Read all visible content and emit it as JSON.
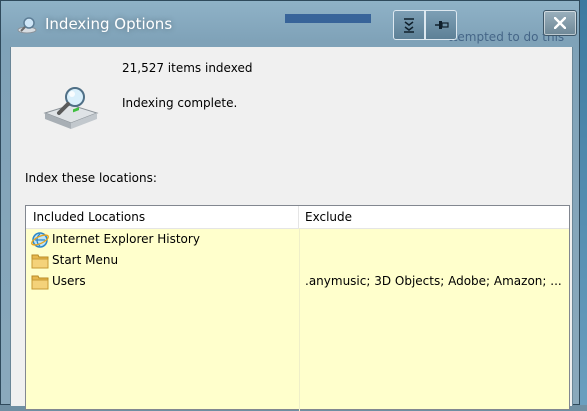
{
  "window": {
    "title": "Indexing Options",
    "background_hint": "ttempted to do this"
  },
  "status": {
    "items_indexed": "21,527 items indexed",
    "state": "Indexing complete."
  },
  "locations": {
    "label": "Index these locations:",
    "columns": {
      "included": "Included Locations",
      "exclude": "Exclude"
    },
    "rows": [
      {
        "name": "Internet Explorer History",
        "exclude": "",
        "icon": "ie-icon"
      },
      {
        "name": "Start Menu",
        "exclude": "",
        "icon": "folder-icon"
      },
      {
        "name": "Users",
        "exclude": ".anymusic; 3D Objects; Adobe; Amazon; ...",
        "icon": "folder-icon"
      }
    ]
  },
  "colors": {
    "list_background": "#ffffcc",
    "client_background": "#f0f0f0",
    "frame": "#7fa2b8"
  }
}
